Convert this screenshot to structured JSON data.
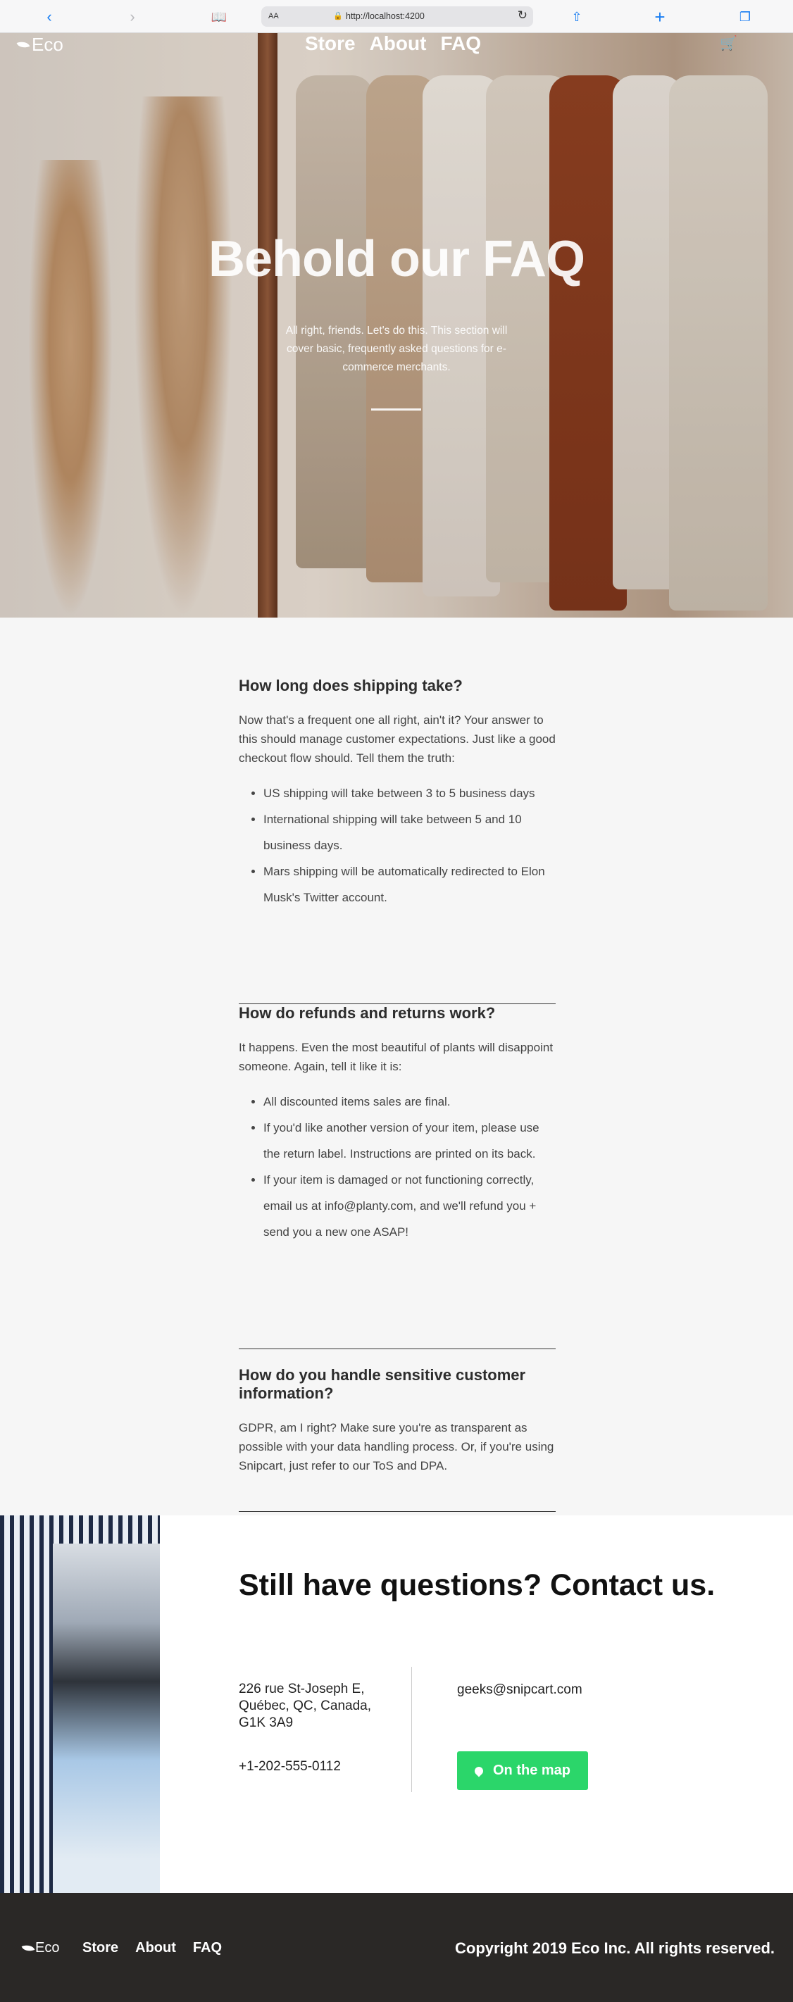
{
  "browser": {
    "text_size_label": "AA",
    "url": "http://localhost:4200"
  },
  "nav": {
    "logo": "Eco",
    "links": [
      "Store",
      "About",
      "FAQ"
    ]
  },
  "hero": {
    "title": "Behold our FAQ",
    "subtitle": "All right, friends. Let's do this. This section will cover basic, frequently asked questions for e-commerce merchants."
  },
  "faq": [
    {
      "question": "How long does shipping take?",
      "answer": "Now that's a frequent one all right, ain't it? Your answer to this should manage customer expectations. Just like a good checkout flow should. Tell them the truth:",
      "bullets": [
        "US shipping will take between 3 to 5 business days",
        "International shipping will take between 5 and 10 business days.",
        "Mars shipping will be automatically redirected to Elon Musk's Twitter account."
      ]
    },
    {
      "question": "How do refunds and returns work?",
      "answer": "It happens. Even the most beautiful of plants will disappoint someone. Again, tell it like it is:",
      "bullets": [
        "All discounted items sales are final.",
        "If you'd like another version of your item, please use the return label. Instructions are printed on its back.",
        "If your item is damaged or not functioning correctly, email us at info@planty.com, and we'll refund you + send you a new one ASAP!"
      ]
    },
    {
      "question": "How do you handle sensitive customer information?",
      "answer": "GDPR, am I right? Make sure you're as transparent as possible with your data handling process. Or, if you're using Snipcart, just refer to our ToS and DPA.",
      "bullets": []
    }
  ],
  "contact": {
    "heading": "Still have questions? Contact us.",
    "address": "226 rue St-Joseph E, Québec, QC, Canada, G1K 3A9",
    "phone": "+1-202-555-0112",
    "email": "geeks@snipcart.com",
    "map_button": "On the map"
  },
  "footer": {
    "logo": "Eco",
    "links": [
      "Store",
      "About",
      "FAQ"
    ],
    "copyright": "Copyright 2019 Eco Inc. All rights reserved."
  },
  "colors": {
    "accent_green": "#2bd66a",
    "footer_bg": "#2a2826",
    "link_blue": "#1a7ef2"
  }
}
